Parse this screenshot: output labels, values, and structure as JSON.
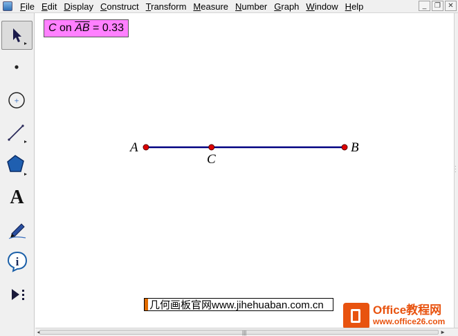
{
  "menu": {
    "items": [
      "File",
      "Edit",
      "Display",
      "Construct",
      "Transform",
      "Measure",
      "Number",
      "Graph",
      "Window",
      "Help"
    ]
  },
  "window_controls": {
    "minimize": "_",
    "restore": "❐",
    "close": "✕"
  },
  "toolbox": {
    "tools": [
      "arrow-select-tool",
      "point-tool",
      "compass-tool",
      "straightedge-tool",
      "polygon-tool",
      "text-tool",
      "marker-tool",
      "information-tool",
      "custom-tool"
    ],
    "text_tool_glyph": "A",
    "info_tool_glyph": "i"
  },
  "measurement": {
    "point": "C",
    "word": " on ",
    "segment": "AB",
    "equals": " = 0.33"
  },
  "segment": {
    "color": "#000080",
    "point_color": "#dd0000",
    "ratio_C": 0.33
  },
  "labels": {
    "A": "A",
    "B": "B",
    "C": "C"
  },
  "caption": {
    "text": "几何画板官网www.jihehuaban.com.cn"
  },
  "watermark": {
    "title": "Office教程网",
    "url": "www.office26.com"
  },
  "scrollbar": {
    "left_arrow": "◄",
    "right_arrow": "►"
  }
}
